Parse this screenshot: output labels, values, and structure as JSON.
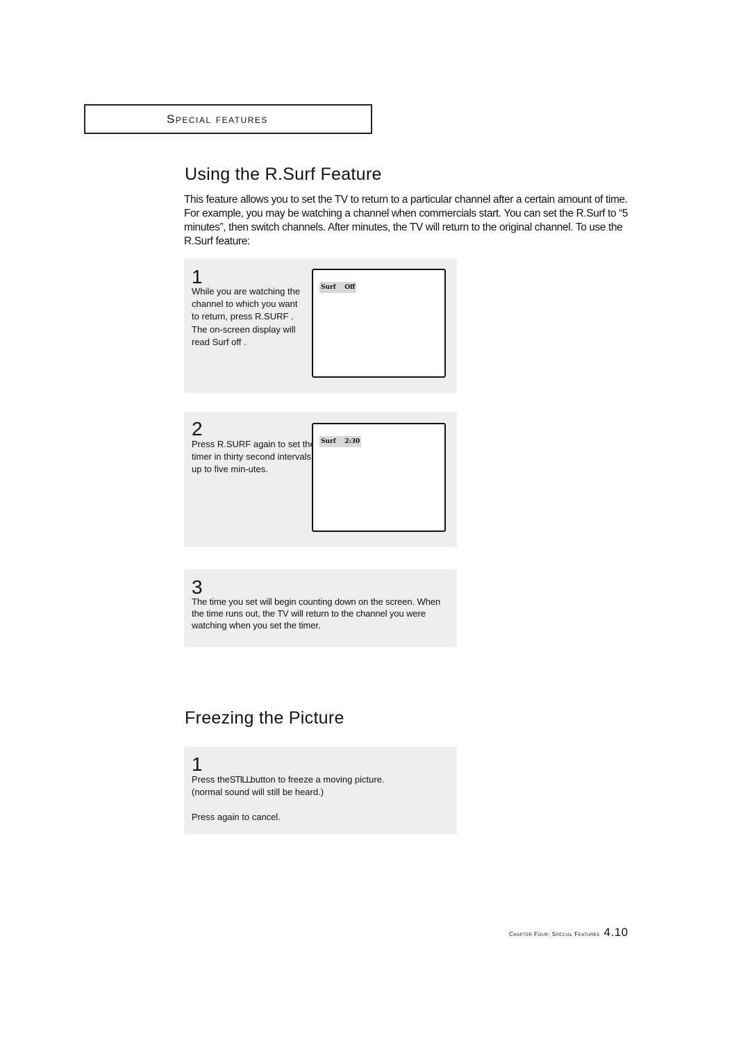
{
  "section_header": "Special Features",
  "sections": [
    {
      "title": "Using the R.Surf Feature",
      "intro": "This feature allows you to set the TV to return to a particular channel after a certain amount of time. For example, you may be watching a channel when commercials start. You can set the R.Surf to “5 minutes”, then switch channels. After minutes, the TV will return to the original channel. To use the R.Surf feature:",
      "steps": [
        {
          "number": "1",
          "text": "While you are watching the channel to which you want to return, press R.SURF . The on-screen display will read  Surf off .",
          "osd": {
            "label": "Surf",
            "value": "Off"
          }
        },
        {
          "number": "2",
          "text": "Press R.SURF again to set the timer in thirty second intervals, up to five min-utes.",
          "osd": {
            "label": "Surf",
            "value": "2:30"
          }
        },
        {
          "number": "3",
          "text": "The time you set will begin counting down on the screen. When the time runs out, the TV will return to the channel you were watching when you set the timer."
        }
      ]
    },
    {
      "title": "Freezing the Picture",
      "steps": [
        {
          "number": "1",
          "text_before": "Press the",
          "button_name": "STILL",
          "text_after": "button to freeze a moving picture.",
          "line2": "(normal sound will still be heard.)",
          "line3": "Press again to cancel."
        }
      ]
    }
  ],
  "footer": {
    "chapter": "Chapter Four: Special Features",
    "page": "4.10"
  }
}
